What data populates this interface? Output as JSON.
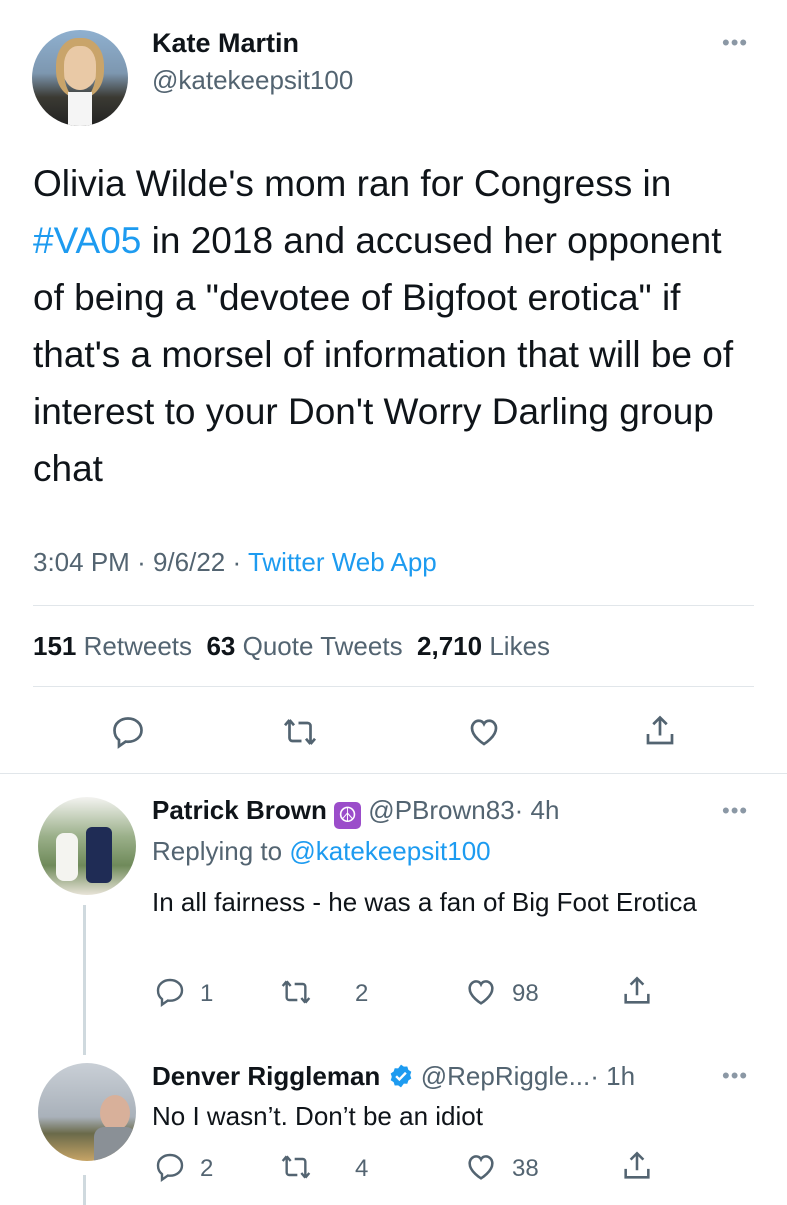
{
  "main_tweet": {
    "author_name": "Kate Martin",
    "author_handle": "@katekeepsit100",
    "text_before": "Olivia Wilde's mom ran for Congress in ",
    "hashtag": "#VA05",
    "text_after": " in 2018 and accused her opponent of being a \"devotee of Bigfoot erotica\" if that's a morsel of information that will be of interest to your Don't Worry Darling group chat",
    "time": "3:04 PM",
    "date": "9/6/22",
    "sep": "·",
    "source": "Twitter Web App",
    "retweets": "151",
    "retweets_label": "Retweets",
    "quotes": "63",
    "quotes_label": "Quote Tweets",
    "likes": "2,710",
    "likes_label": "Likes"
  },
  "replies": [
    {
      "author_name": "Patrick Brown",
      "badge": "☮",
      "handle": "@PBrown83",
      "time": "· 4h",
      "replying_label": "Replying to",
      "replying_to": "@katekeepsit100",
      "text": "In all fairness - he was a fan of Big Foot Erotica",
      "replies": "1",
      "retweets": "2",
      "likes": "98"
    },
    {
      "author_name": "Denver Riggleman",
      "handle": "@RepRiggle...",
      "time": "· 1h",
      "text": "No I wasn’t. Don’t be an idiot",
      "replies": "2",
      "retweets": "4",
      "likes": "38"
    }
  ],
  "more_label": "•••",
  "colors": {
    "accent": "#1d9bf0",
    "secondary": "#536471",
    "peace_badge": "#9b4dca"
  }
}
